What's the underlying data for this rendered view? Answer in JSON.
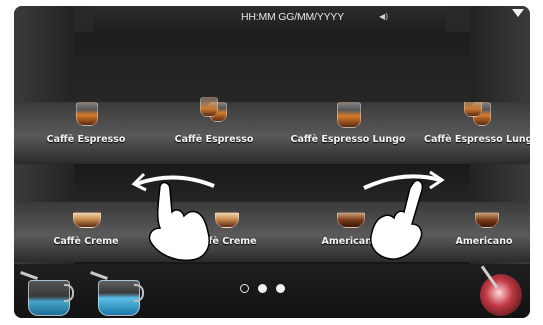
{
  "status_bar": {
    "clock": "HH:MM GG/MM/YYYY",
    "speaker_icon": "speaker-icon",
    "menu_icon": "dropdown-arrow-icon"
  },
  "row1": [
    {
      "label": "Caffè Espresso",
      "icon": "espresso-cup-icon"
    },
    {
      "label": "Caffè Espresso",
      "icon": "double-espresso-cup-icon"
    },
    {
      "label": "Caffè Espresso Lungo",
      "icon": "espresso-lungo-cup-icon"
    },
    {
      "label": "Caffè Espresso Lungo",
      "icon": "double-espresso-lungo-cup-icon"
    }
  ],
  "row2": [
    {
      "label": "Caffè Creme",
      "icon": "creme-cup-icon"
    },
    {
      "label": "Caffè Creme",
      "icon": "double-creme-cup-icon"
    },
    {
      "label": "Americano",
      "icon": "americano-cup-icon"
    },
    {
      "label": "Americano",
      "icon": "double-americano-cup-icon"
    }
  ],
  "bottom_bar": {
    "left_icons": [
      "milk-jug-icon",
      "hot-water-jug-icon"
    ],
    "page_indicator": {
      "pages": 3,
      "current": 2
    },
    "right_icon": "steam-wand-icon"
  },
  "gestures": [
    "swipe-left-hand-icon",
    "swipe-right-hand-icon"
  ],
  "colors": {
    "background": "#1b1b1b",
    "text": "#f4f4f4",
    "accent_coffee": "#d77a2a",
    "accent_water": "#4aa3c8"
  }
}
